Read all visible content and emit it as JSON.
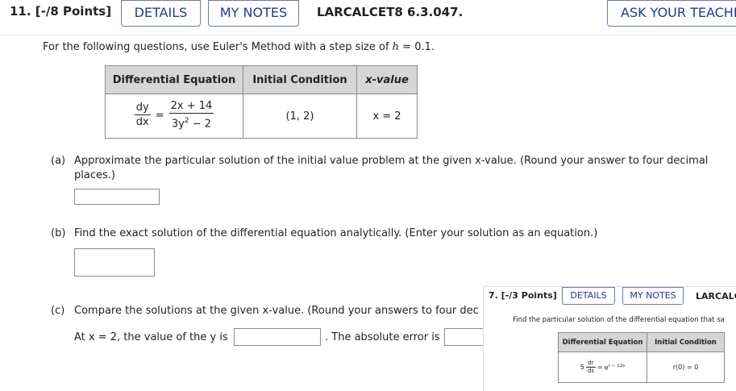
{
  "header": {
    "question_number": "11.  [-/8 Points]",
    "details_label": "DETAILS",
    "notes_label": "MY NOTES",
    "reference": "LARCALCET8 6.3.047.",
    "ask_label": "ASK YOUR TEACHE"
  },
  "instructions": {
    "prefix": "For the following questions, use Euler's Method with a step size of ",
    "var": "h",
    "suffix": " = 0.1."
  },
  "table": {
    "headers": [
      "Differential Equation",
      "Initial Condition",
      "x-value"
    ],
    "equation": {
      "lhs_num": "dy",
      "lhs_den": "dx",
      "equals": "=",
      "rhs_num": "2x + 14",
      "rhs_den_base": "3y",
      "rhs_den_exp": "2",
      "rhs_den_tail": " − 2"
    },
    "initial_condition": "(1, 2)",
    "x_value": "x = 2"
  },
  "part_a": {
    "label": "(a)",
    "text": "Approximate the particular solution of the initial value problem at the given x-value. (Round your answer to four decimal places.)",
    "answer": ""
  },
  "part_b": {
    "label": "(b)",
    "text": "Find the exact solution of the differential equation analytically. (Enter your solution as an equation.)",
    "answer": ""
  },
  "part_c": {
    "label": "(c)",
    "text": "Compare the solutions at the given x-value. (Round your answers to four dec",
    "line2_prefix": "At x = 2, the value of the y is",
    "line2_middle": ". The absolute error is",
    "answer_y": "",
    "answer_error": ""
  },
  "overlay_question": {
    "question_number": "7.  [-/3 Points]",
    "details_label": "DETAILS",
    "notes_label": "MY NOTES",
    "reference": "LARCALC",
    "instructions": "Find the particular solution of the differential equation that sa",
    "headers": [
      "Differential Equation",
      "Initial Condition"
    ],
    "equation": {
      "coef": "5",
      "num": "dr",
      "den": "ds",
      "equals": "=",
      "rhs_base": "e",
      "rhs_exp": "r − 12s"
    },
    "initial_condition": "r(0) = 0"
  }
}
